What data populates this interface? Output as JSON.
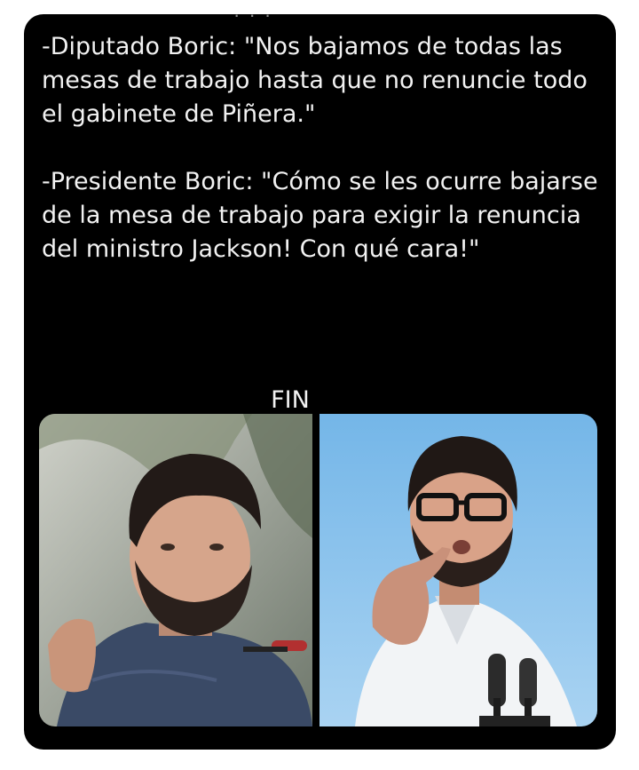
{
  "post": {
    "cut_line": "· · ·",
    "paragraphs": [
      "-Diputado Boric: \"Nos bajamos de todas las mesas de trabajo hasta que no renuncie todo el gabinete de Piñera.\"",
      "-Presidente Boric: \"Cómo se les ocurre bajarse de la mesa de trabajo para exigir la renuncia del ministro Jackson! Con qué cara!\""
    ],
    "closing": "FIN"
  },
  "media": {
    "images": [
      {
        "label": "left-photo"
      },
      {
        "label": "right-photo"
      }
    ]
  },
  "colors": {
    "card_background": "#000000",
    "text": "#f2f2f2",
    "page_background": "#ffffff"
  }
}
